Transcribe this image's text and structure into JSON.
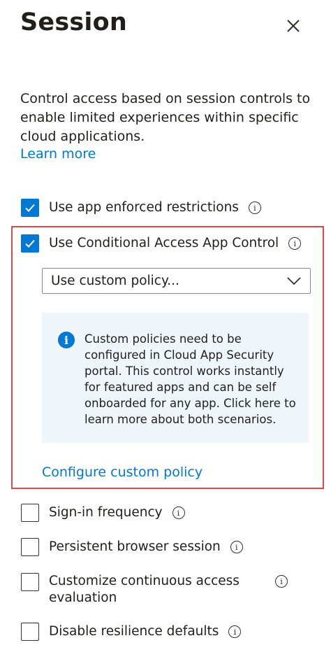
{
  "panel": {
    "title": "Session",
    "description": "Control access based on session controls to enable limited experiences within specific cloud applications.",
    "learn_more": "Learn more"
  },
  "controls": {
    "app_enforced": {
      "label": "Use app enforced restrictions",
      "checked": true
    },
    "conditional_access": {
      "label": "Use Conditional Access App Control",
      "checked": true
    },
    "policy_select": {
      "value": "Use custom policy..."
    },
    "info_message": "Custom policies need to be configured in Cloud App Security portal. This control works instantly for featured apps and can be self onboarded for any app. Click here to learn more about both scenarios.",
    "configure_link": "Configure custom policy",
    "signin_frequency": {
      "label": "Sign-in frequency",
      "checked": false
    },
    "persistent_browser": {
      "label": "Persistent browser session",
      "checked": false
    },
    "continuous_access": {
      "label_line1": "Customize continuous access",
      "label_line2": "evaluation",
      "checked": false
    },
    "resilience": {
      "label": "Disable resilience defaults",
      "checked": false
    }
  },
  "colors": {
    "accent": "#0078d4",
    "highlight_border": "#e0484b",
    "info_background": "#eff6fc"
  },
  "icons": [
    "close-icon",
    "checkmark-icon",
    "info-icon",
    "chevron-down-icon"
  ]
}
